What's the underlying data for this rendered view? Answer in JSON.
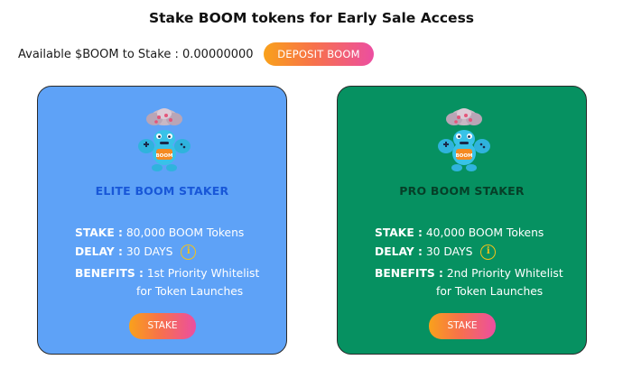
{
  "header": {
    "title": "Stake BOOM tokens for Early Sale Access",
    "balance_label": "Available $BOOM to Stake :",
    "balance_value": "0.00000000",
    "deposit_button": "DEPOSIT BOOM"
  },
  "cards": [
    {
      "title": "ELITE BOOM STAKER",
      "stake_label": "STAKE :",
      "stake_value": "80,000 BOOM Tokens",
      "delay_label": "DELAY :",
      "delay_value": "30 DAYS",
      "benefits_label": "BENEFITS :",
      "benefits_line1": "1st Priority Whitelist",
      "benefits_line2": "for Token Launches",
      "button": "STAKE",
      "mascot_text": "BOOM",
      "info_icon": "i"
    },
    {
      "title": "PRO BOOM STAKER",
      "stake_label": "STAKE :",
      "stake_value": "40,000 BOOM Tokens",
      "delay_label": "DELAY :",
      "delay_value": "30 DAYS",
      "benefits_label": "BENEFITS :",
      "benefits_line1": "2nd Priority Whitelist",
      "benefits_line2": "for Token Launches",
      "button": "STAKE",
      "mascot_text": "BOOM",
      "info_icon": "i"
    }
  ],
  "colors": {
    "elite_card_bg": "#5ea2f7",
    "pro_card_bg": "#069161",
    "elite_title": "#1857d8",
    "pro_title": "#063f28",
    "button_gradient_start": "#f9a11b",
    "button_gradient_end": "#ec4ea1",
    "info_icon": "#f4c21a"
  },
  "icons": {
    "mascot": "boom-mascot-icon",
    "info": "info-icon"
  }
}
